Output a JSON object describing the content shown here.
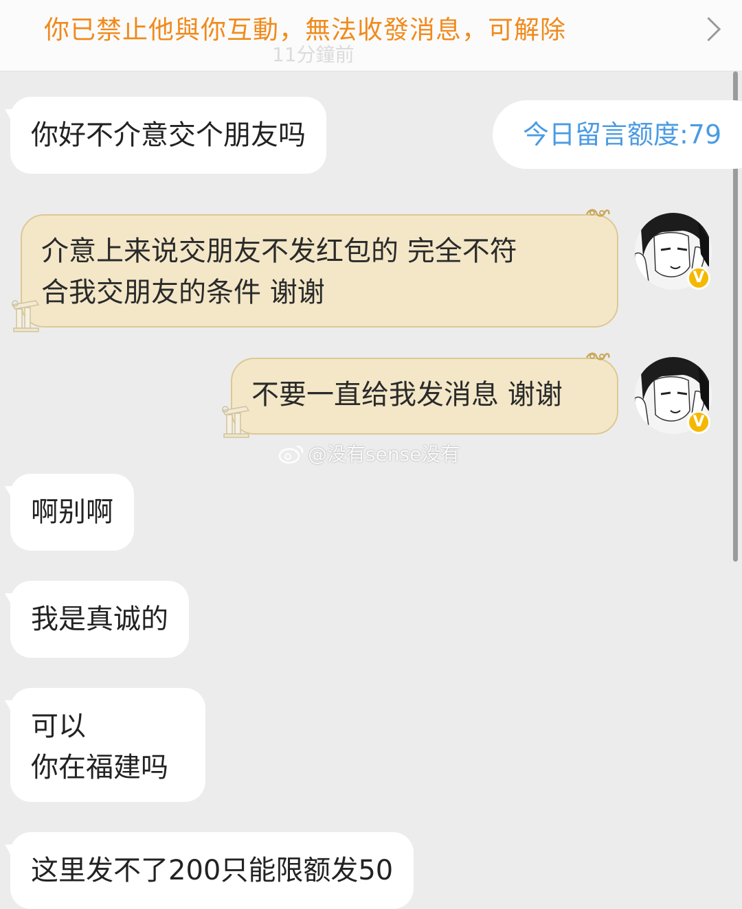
{
  "banner": {
    "notice": "你已禁止他與你互動，無法收發消息，可解除",
    "ghost_time": "11分鐘前"
  },
  "quota": {
    "label": "今日留言额度:79"
  },
  "messages": [
    {
      "side": "incoming",
      "text": "你好不介意交个朋友吗"
    },
    {
      "side": "outgoing",
      "line1": "介意上来说交朋友不发红包的  完全不符",
      "line2": "合我交朋友的条件 谢谢"
    },
    {
      "side": "outgoing",
      "text": "不要一直给我发消息 谢谢"
    },
    {
      "side": "incoming",
      "text": "啊别啊"
    },
    {
      "side": "incoming",
      "text": "我是真诚的"
    },
    {
      "side": "incoming",
      "line1": "可以",
      "line2": "你在福建吗"
    },
    {
      "side": "incoming",
      "text": "这里发不了200只能限额发50"
    }
  ],
  "watermark": {
    "text": "@没有sense没有"
  },
  "avatar": {
    "badge": "V"
  },
  "colors": {
    "banner_text": "#f08a1c",
    "quota_text": "#4a9be3",
    "outgoing_bubble": "#f3e7c8",
    "incoming_bubble": "#ffffff",
    "background": "#ececec"
  }
}
